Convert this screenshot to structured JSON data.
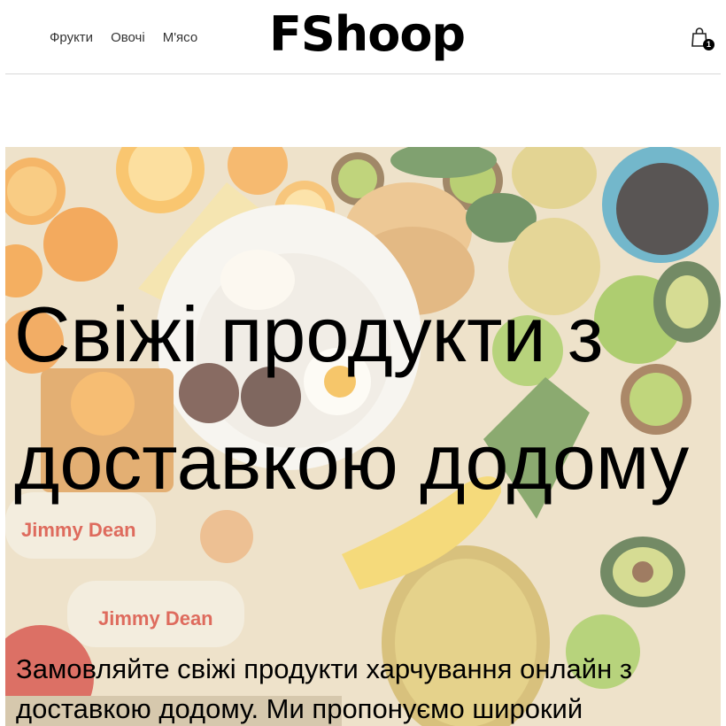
{
  "header": {
    "nav": [
      "Фрукти",
      "Овочі",
      "М'ясо"
    ],
    "logo": "FShoop",
    "cart_count": "1",
    "cart_icon": "shopping-bag-icon"
  },
  "hero": {
    "title": "Свіжі продукти з доставкою додому",
    "text": "Замовляйте свіжі продукти харчування онлайн з доставкою додому. Ми пропонуємо широкий",
    "image_label_1": "Jimmy Dean",
    "image_label_2": "Jimmy Dean"
  },
  "colors": {
    "accent": "#000000",
    "divider": "#d8d8d8"
  }
}
